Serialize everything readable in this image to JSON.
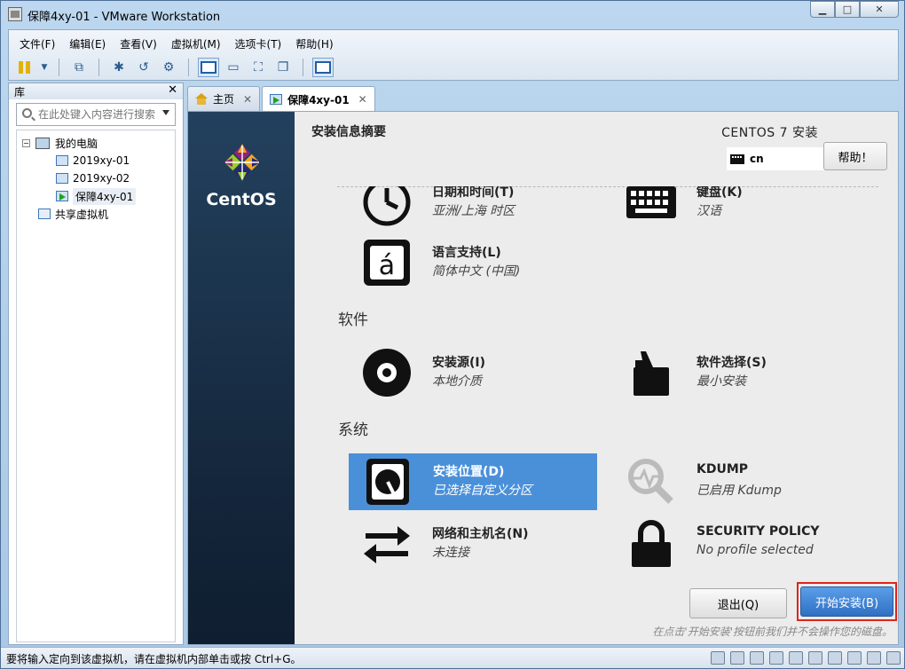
{
  "window": {
    "title": "保障4xy-01 - VMware Workstation"
  },
  "menu": [
    "文件(F)",
    "编辑(E)",
    "查看(V)",
    "虚拟机(M)",
    "选项卡(T)",
    "帮助(H)"
  ],
  "library": {
    "title": "库",
    "search_placeholder": "在此处键入内容进行搜索",
    "tree": {
      "root": "我的电脑",
      "vms": [
        "2019xy-01",
        "2019xy-02",
        "保障4xy-01"
      ],
      "shared": "共享虚拟机"
    }
  },
  "tabs": [
    {
      "label": "主页"
    },
    {
      "label": "保障4xy-01"
    }
  ],
  "guest": {
    "brand": "CentOS",
    "page_title": "安装信息摘要",
    "product": "CENTOS 7 安装",
    "keyboard_layout": "cn",
    "help_label": "帮助！",
    "localization": {
      "datetime": {
        "title": "日期和时间(T)",
        "status": "亚洲/上海 时区"
      },
      "keyboard": {
        "title": "键盘(K)",
        "status": "汉语"
      },
      "language": {
        "title": "语言支持(L)",
        "status": "简体中文 (中国)"
      }
    },
    "software": {
      "heading": "软件",
      "source": {
        "title": "安装源(I)",
        "status": "本地介质"
      },
      "selection": {
        "title": "软件选择(S)",
        "status": "最小安装"
      }
    },
    "system": {
      "heading": "系统",
      "destination": {
        "title": "安装位置(D)",
        "status": "已选择自定义分区"
      },
      "kdump": {
        "title": "KDUMP",
        "status": "已启用 Kdump"
      },
      "network": {
        "title": "网络和主机名(N)",
        "status": "未连接"
      },
      "security": {
        "title": "SECURITY POLICY",
        "status": "No profile selected"
      }
    },
    "quit_label": "退出(Q)",
    "begin_label": "开始安装(B)",
    "note": "在点击'开始安装'按钮前我们并不会操作您的磁盘。"
  },
  "status_bar": "要将输入定向到该虚拟机，请在虚拟机内部单击或按 Ctrl+G。",
  "colors": {
    "selected_spoke": "#4a90d9",
    "begin_button": "#3b7fd4",
    "highlight_box": "#e0241a"
  }
}
